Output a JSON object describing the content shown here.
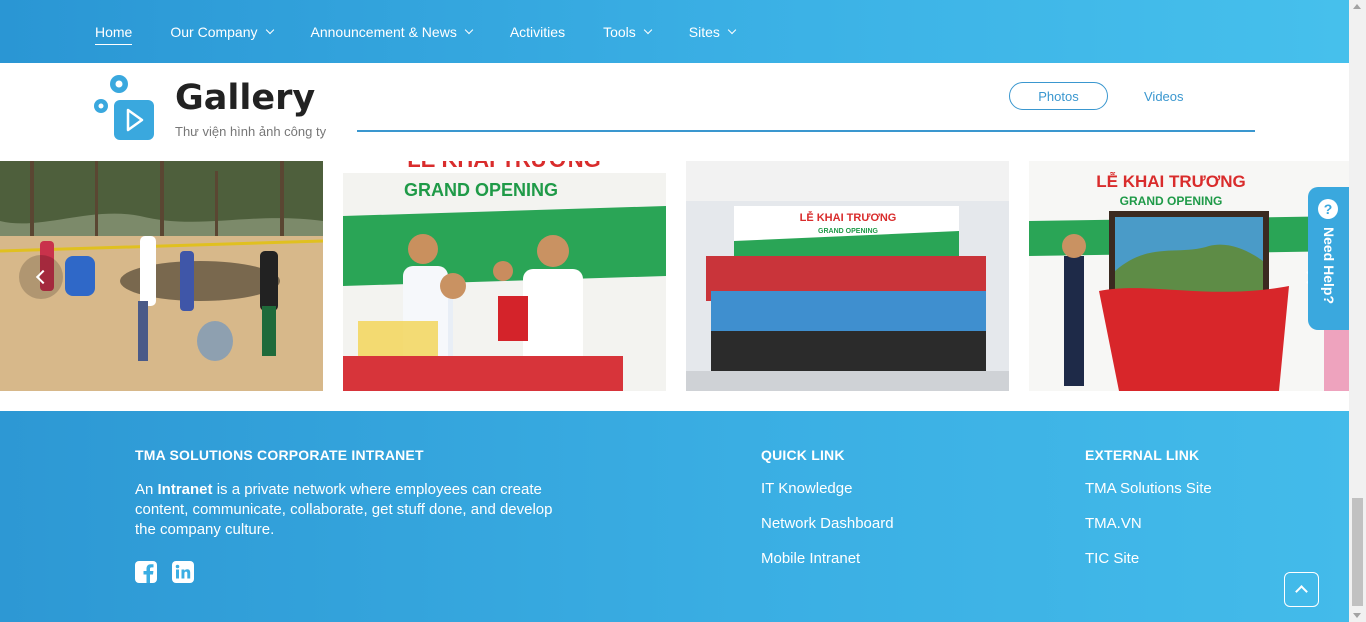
{
  "nav": {
    "items": [
      {
        "label": "Home",
        "active": true,
        "dropdown": false
      },
      {
        "label": "Our Company",
        "active": false,
        "dropdown": true
      },
      {
        "label": "Announcement & News",
        "active": false,
        "dropdown": true
      },
      {
        "label": "Activities",
        "active": false,
        "dropdown": false
      },
      {
        "label": "Tools",
        "active": false,
        "dropdown": true
      },
      {
        "label": "Sites",
        "active": false,
        "dropdown": true
      }
    ]
  },
  "gallery": {
    "title": "Gallery",
    "subtitle": "Thư viện hình ảnh công ty",
    "tabs": {
      "photos": "Photos",
      "videos": "Videos"
    },
    "accent_color": "#3a97cf",
    "photos": [
      {
        "banner": "",
        "subbanner": ""
      },
      {
        "banner": "LỄ KHAI TRƯƠNG",
        "subbanner": "GRAND OPENING"
      },
      {
        "banner": "LỄ KHAI TRƯƠNG",
        "subbanner": "GRAND OPENING"
      },
      {
        "banner": "LỄ KHAI TRƯƠNG",
        "subbanner": "GRAND OPENING"
      }
    ]
  },
  "help": {
    "icon": "question-icon",
    "label": "Need Help?"
  },
  "footer": {
    "about": {
      "heading": "TMA SOLUTIONS CORPORATE INTRANET",
      "text_pre": "An ",
      "text_bold": "Intranet",
      "text_post": " is a private network where employees can create content, communicate, collaborate, get stuff done, and develop the company culture."
    },
    "quick_link": {
      "heading": "QUICK LINK",
      "items": [
        "IT Knowledge",
        "Network Dashboard",
        "Mobile Intranet"
      ]
    },
    "external_link": {
      "heading": "EXTERNAL LINK",
      "items": [
        "TMA Solutions Site",
        "TMA.VN",
        "TIC Site"
      ]
    },
    "social_icons": [
      "facebook-icon",
      "linkedin-icon"
    ]
  },
  "colors": {
    "nav_bg": "#3aaee3",
    "footer_bg": "#3aaee3",
    "banner_green": "#1fa24a",
    "banner_red": "#d82b2b"
  }
}
